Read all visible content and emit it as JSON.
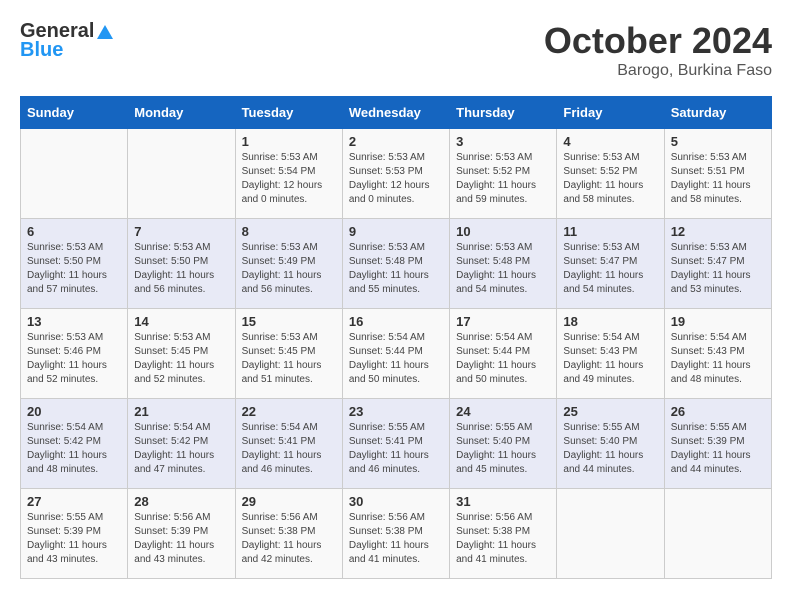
{
  "header": {
    "logo_general": "General",
    "logo_blue": "Blue",
    "month": "October 2024",
    "location": "Barogo, Burkina Faso"
  },
  "weekdays": [
    "Sunday",
    "Monday",
    "Tuesday",
    "Wednesday",
    "Thursday",
    "Friday",
    "Saturday"
  ],
  "weeks": [
    [
      {
        "day": "",
        "info": ""
      },
      {
        "day": "",
        "info": ""
      },
      {
        "day": "1",
        "info": "Sunrise: 5:53 AM\nSunset: 5:54 PM\nDaylight: 12 hours\nand 0 minutes."
      },
      {
        "day": "2",
        "info": "Sunrise: 5:53 AM\nSunset: 5:53 PM\nDaylight: 12 hours\nand 0 minutes."
      },
      {
        "day": "3",
        "info": "Sunrise: 5:53 AM\nSunset: 5:52 PM\nDaylight: 11 hours\nand 59 minutes."
      },
      {
        "day": "4",
        "info": "Sunrise: 5:53 AM\nSunset: 5:52 PM\nDaylight: 11 hours\nand 58 minutes."
      },
      {
        "day": "5",
        "info": "Sunrise: 5:53 AM\nSunset: 5:51 PM\nDaylight: 11 hours\nand 58 minutes."
      }
    ],
    [
      {
        "day": "6",
        "info": "Sunrise: 5:53 AM\nSunset: 5:50 PM\nDaylight: 11 hours\nand 57 minutes."
      },
      {
        "day": "7",
        "info": "Sunrise: 5:53 AM\nSunset: 5:50 PM\nDaylight: 11 hours\nand 56 minutes."
      },
      {
        "day": "8",
        "info": "Sunrise: 5:53 AM\nSunset: 5:49 PM\nDaylight: 11 hours\nand 56 minutes."
      },
      {
        "day": "9",
        "info": "Sunrise: 5:53 AM\nSunset: 5:48 PM\nDaylight: 11 hours\nand 55 minutes."
      },
      {
        "day": "10",
        "info": "Sunrise: 5:53 AM\nSunset: 5:48 PM\nDaylight: 11 hours\nand 54 minutes."
      },
      {
        "day": "11",
        "info": "Sunrise: 5:53 AM\nSunset: 5:47 PM\nDaylight: 11 hours\nand 54 minutes."
      },
      {
        "day": "12",
        "info": "Sunrise: 5:53 AM\nSunset: 5:47 PM\nDaylight: 11 hours\nand 53 minutes."
      }
    ],
    [
      {
        "day": "13",
        "info": "Sunrise: 5:53 AM\nSunset: 5:46 PM\nDaylight: 11 hours\nand 52 minutes."
      },
      {
        "day": "14",
        "info": "Sunrise: 5:53 AM\nSunset: 5:45 PM\nDaylight: 11 hours\nand 52 minutes."
      },
      {
        "day": "15",
        "info": "Sunrise: 5:53 AM\nSunset: 5:45 PM\nDaylight: 11 hours\nand 51 minutes."
      },
      {
        "day": "16",
        "info": "Sunrise: 5:54 AM\nSunset: 5:44 PM\nDaylight: 11 hours\nand 50 minutes."
      },
      {
        "day": "17",
        "info": "Sunrise: 5:54 AM\nSunset: 5:44 PM\nDaylight: 11 hours\nand 50 minutes."
      },
      {
        "day": "18",
        "info": "Sunrise: 5:54 AM\nSunset: 5:43 PM\nDaylight: 11 hours\nand 49 minutes."
      },
      {
        "day": "19",
        "info": "Sunrise: 5:54 AM\nSunset: 5:43 PM\nDaylight: 11 hours\nand 48 minutes."
      }
    ],
    [
      {
        "day": "20",
        "info": "Sunrise: 5:54 AM\nSunset: 5:42 PM\nDaylight: 11 hours\nand 48 minutes."
      },
      {
        "day": "21",
        "info": "Sunrise: 5:54 AM\nSunset: 5:42 PM\nDaylight: 11 hours\nand 47 minutes."
      },
      {
        "day": "22",
        "info": "Sunrise: 5:54 AM\nSunset: 5:41 PM\nDaylight: 11 hours\nand 46 minutes."
      },
      {
        "day": "23",
        "info": "Sunrise: 5:55 AM\nSunset: 5:41 PM\nDaylight: 11 hours\nand 46 minutes."
      },
      {
        "day": "24",
        "info": "Sunrise: 5:55 AM\nSunset: 5:40 PM\nDaylight: 11 hours\nand 45 minutes."
      },
      {
        "day": "25",
        "info": "Sunrise: 5:55 AM\nSunset: 5:40 PM\nDaylight: 11 hours\nand 44 minutes."
      },
      {
        "day": "26",
        "info": "Sunrise: 5:55 AM\nSunset: 5:39 PM\nDaylight: 11 hours\nand 44 minutes."
      }
    ],
    [
      {
        "day": "27",
        "info": "Sunrise: 5:55 AM\nSunset: 5:39 PM\nDaylight: 11 hours\nand 43 minutes."
      },
      {
        "day": "28",
        "info": "Sunrise: 5:56 AM\nSunset: 5:39 PM\nDaylight: 11 hours\nand 43 minutes."
      },
      {
        "day": "29",
        "info": "Sunrise: 5:56 AM\nSunset: 5:38 PM\nDaylight: 11 hours\nand 42 minutes."
      },
      {
        "day": "30",
        "info": "Sunrise: 5:56 AM\nSunset: 5:38 PM\nDaylight: 11 hours\nand 41 minutes."
      },
      {
        "day": "31",
        "info": "Sunrise: 5:56 AM\nSunset: 5:38 PM\nDaylight: 11 hours\nand 41 minutes."
      },
      {
        "day": "",
        "info": ""
      },
      {
        "day": "",
        "info": ""
      }
    ]
  ]
}
